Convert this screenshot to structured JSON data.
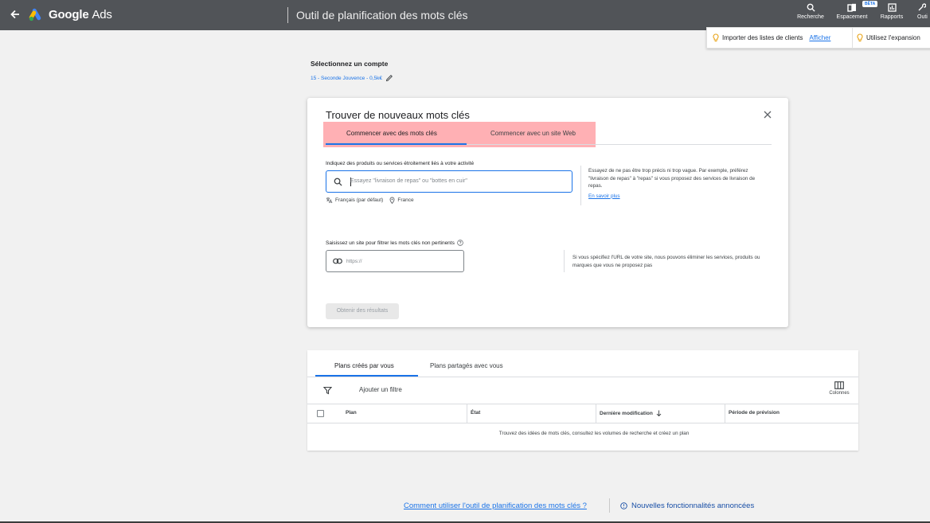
{
  "topbar": {
    "brand_bold": "Google",
    "brand_light": "Ads",
    "page_title": "Outil de planification des mots clés",
    "tools": [
      {
        "label": "Recherche",
        "icon": "search-icon"
      },
      {
        "label": "Espacement",
        "icon": "appearance-icon",
        "badge": "BÊTA"
      },
      {
        "label": "Rapports",
        "icon": "reports-icon"
      },
      {
        "label": "Outi",
        "icon": "tools-icon"
      }
    ]
  },
  "notifications": {
    "import_text": "Importer des listes de clients",
    "import_link": "Afficher",
    "expansion_text": "Utilisez l'expansion"
  },
  "account": {
    "label": "Sélectionnez un compte",
    "value": "15 - Seconde Jouvence - 0,5k€"
  },
  "finder": {
    "title": "Trouver de nouveaux mots clés",
    "tab_keywords": "Commencer avec des mots clés",
    "tab_website": "Commencer avec un site Web",
    "products_label": "Indiquez des produits ou services étroitement liés à votre activité",
    "search_placeholder": "Essayez \"livraison de repas\" ou \"bottes en cuir\"",
    "language": "Français (par défaut)",
    "location": "France",
    "hint_text": "Essayez de ne pas être trop précis ni trop vague. Par exemple, préférez \"livraison de repas\" à \"repas\" si vous proposez des services de livraison de repas.",
    "learn_more": "En savoir plus",
    "site_label": "Saisissez un site pour filtrer les mots clés non pertinents",
    "url_placeholder": "https://",
    "site_hint": "Si vous spécifiez l'URL de votre site, nous pouvons éliminer les services, produits ou marques que vous ne proposez pas",
    "results_button": "Obtenir des résultats"
  },
  "plans": {
    "tab_created": "Plans créés par vous",
    "tab_shared": "Plans partagés avec vous",
    "add_filter": "Ajouter un filtre",
    "columns_label": "Colonnes",
    "headers": [
      "Plan",
      "État",
      "Dernière modification",
      "Période de prévision"
    ],
    "empty_text": "Trouvez des idées de mots clés, consultez les volumes de recherche et créez un plan"
  },
  "footer": {
    "help_link": "Comment utiliser l'outil de planification des mots clés ?",
    "new_features": "Nouvelles fonctionnalités annoncées"
  },
  "colors": {
    "topbar": "#515458",
    "accent": "#1a73e8",
    "tab_highlight": "#ff969b"
  }
}
